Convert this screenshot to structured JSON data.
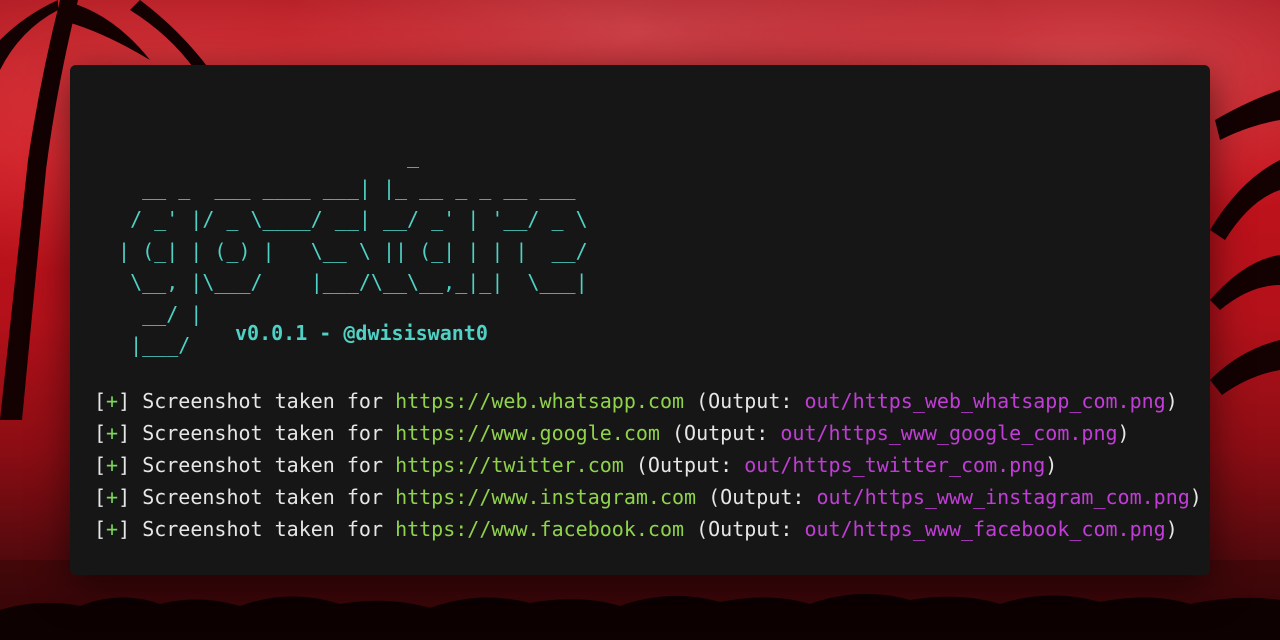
{
  "banner": {
    "ascii": "                         _\n   __ _  ___ ____ ___| |_ __ _ _ __ ___\n  / _' |/ _ \\____/ __| __/ _' | '__/ _ \\\n | (_| | (_) |   \\__ \\ || (_| | | |  __/\n  \\__, |\\___/    |___/\\__\\__,_|_|  \\___|\n   __/ |\n  |___/",
    "version": "v0.0.1 - @dwisiswant0"
  },
  "log": {
    "prefix_open": "[",
    "prefix_plus": "+",
    "prefix_close": "]",
    "message": "Screenshot taken for",
    "output_open": "(Output:",
    "output_close": ")",
    "entries": [
      {
        "url": "https://web.whatsapp.com",
        "output": "out/https_web_whatsapp_com.png"
      },
      {
        "url": "https://www.google.com",
        "output": "out/https_www_google_com.png"
      },
      {
        "url": "https://twitter.com",
        "output": "out/https_twitter_com.png"
      },
      {
        "url": "https://www.instagram.com",
        "output": "out/https_www_instagram_com.png"
      },
      {
        "url": "https://www.facebook.com",
        "output": "out/https_www_facebook_com.png"
      }
    ]
  },
  "colors": {
    "banner": "#4fd1c5",
    "plus": "#7cd65a",
    "url": "#8fd34a",
    "path": "#c23cd8",
    "text": "#e6e6e6",
    "terminal_bg": "#161616"
  }
}
